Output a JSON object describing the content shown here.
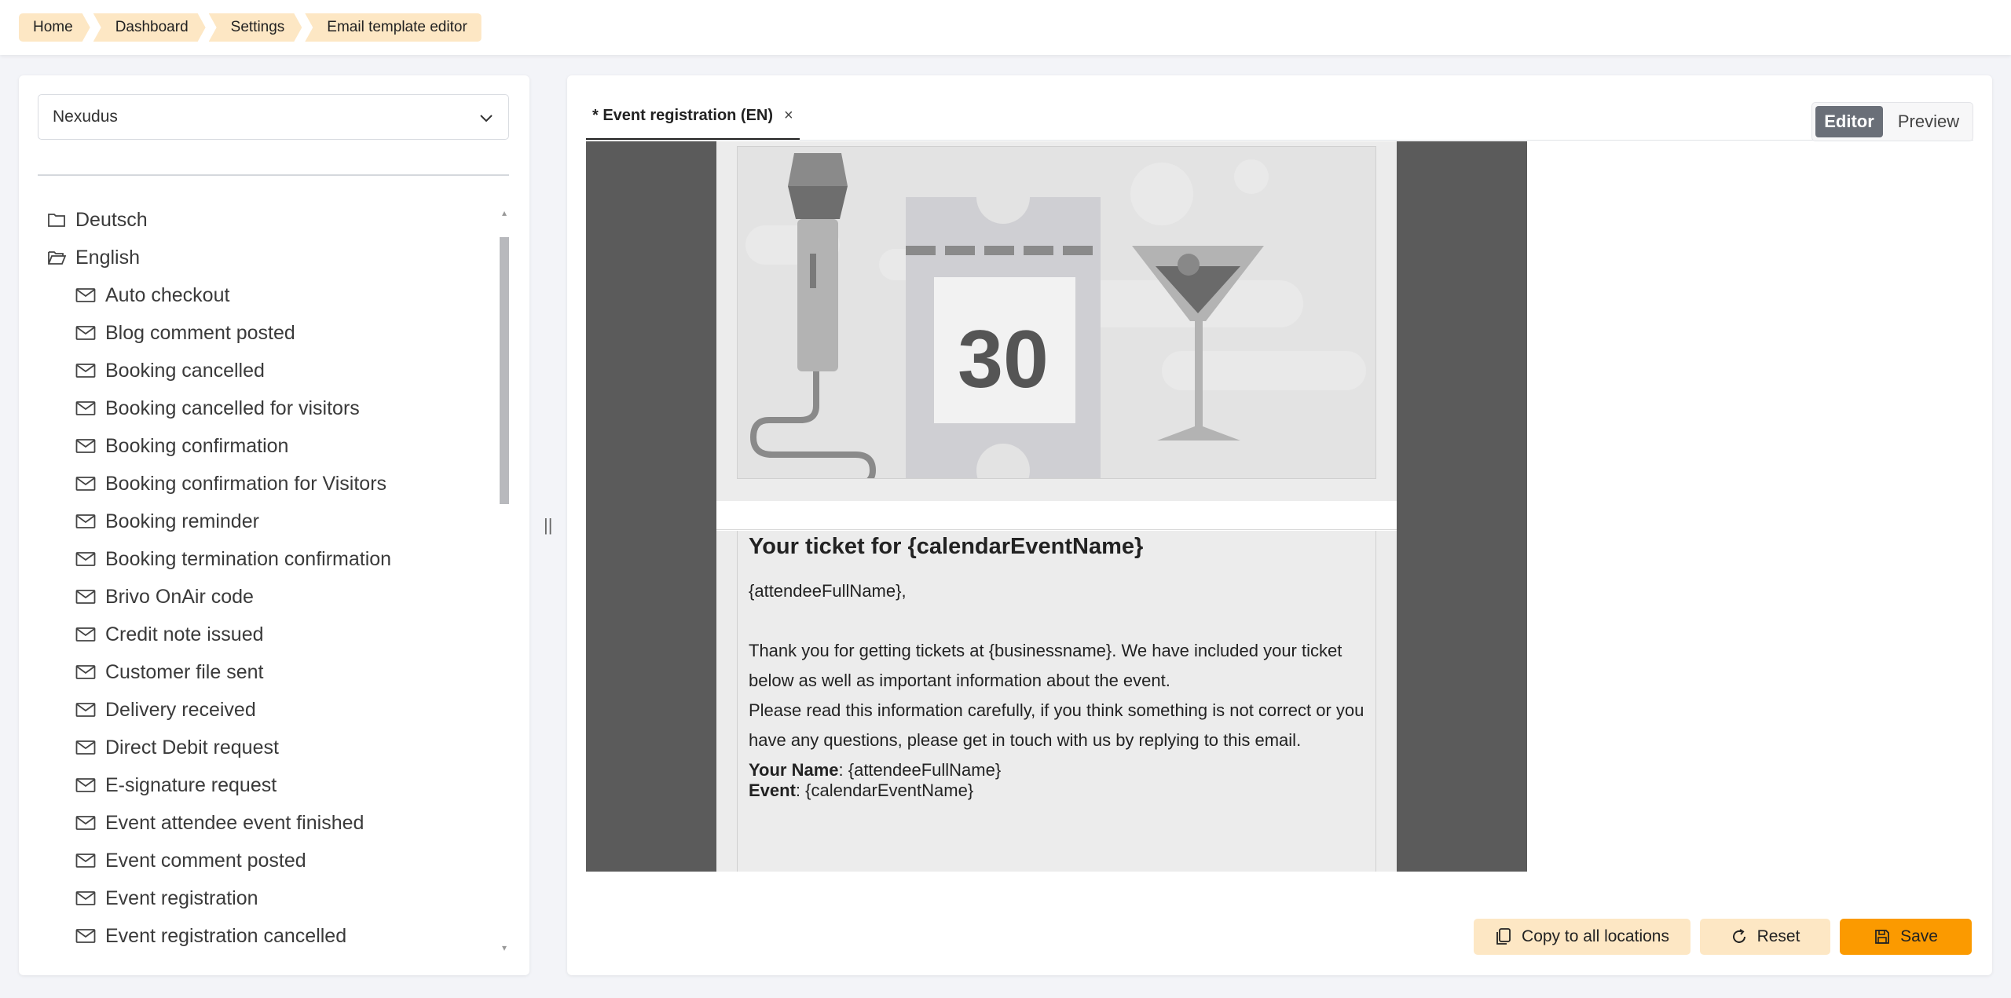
{
  "breadcrumbs": [
    "Home",
    "Dashboard",
    "Settings",
    "Email template editor"
  ],
  "location_select": {
    "value": "Nexudus"
  },
  "tree": {
    "folders": [
      {
        "label": "Deutsch",
        "open": false
      },
      {
        "label": "English",
        "open": true
      }
    ],
    "templates": [
      "Auto checkout",
      "Blog comment posted",
      "Booking cancelled",
      "Booking cancelled for visitors",
      "Booking confirmation",
      "Booking confirmation for Visitors",
      "Booking reminder",
      "Booking termination confirmation",
      "Brivo OnAir code",
      "Credit note issued",
      "Customer file sent",
      "Delivery received",
      "Direct Debit request",
      "E-signature request",
      "Event attendee event finished",
      "Event comment posted",
      "Event registration",
      "Event registration cancelled"
    ]
  },
  "tab": {
    "label": "* Event registration (EN)",
    "close": "×"
  },
  "mode": {
    "editor": "Editor",
    "preview": "Preview",
    "active": "Editor"
  },
  "email": {
    "hero_number": "30",
    "title": "Your ticket for {calendarEventName}",
    "greeting": "{attendeeFullName},",
    "para1": "Thank you for getting tickets at {businessname}. We have included your ticket below as well as important information about the event.",
    "para2": "Please read this information carefully, if you think something is not correct or you have any questions, please get in touch with us by replying to this email.",
    "name_label": "Your Name",
    "name_value": ": {attendeeFullName}",
    "event_label": "Event",
    "event_value": ": {calendarEventName}"
  },
  "buttons": {
    "copy": "Copy to all locations",
    "reset": "Reset",
    "save": "Save"
  },
  "colors": {
    "accent": "#fb9a00",
    "soft_accent": "#fde7c4",
    "toggle_active": "#6a6f78"
  }
}
